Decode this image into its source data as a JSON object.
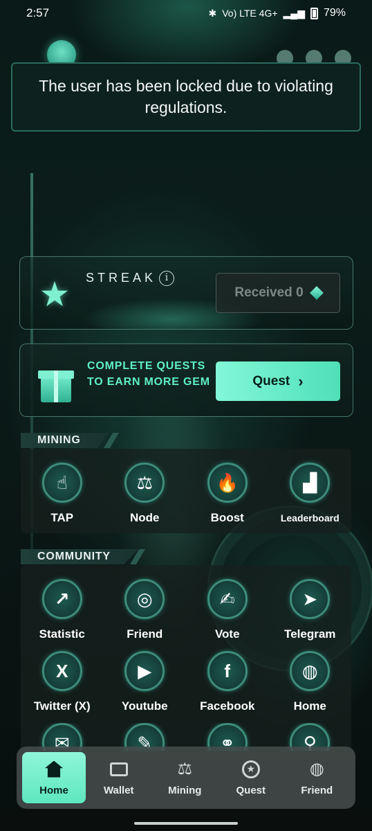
{
  "status_bar": {
    "time": "2:57",
    "network": "Vo) LTE 4G+",
    "battery": "79%"
  },
  "toast": {
    "message": "The user has been locked due to violating regulations."
  },
  "streak": {
    "title": "STREAK",
    "info_glyph": "i",
    "received_label": "Received 0"
  },
  "quest_card": {
    "text": "COMPLETE QUESTS TO EARN MORE GEM",
    "button_label": "Quest"
  },
  "mining": {
    "label": "MINING",
    "items": [
      {
        "label": "TAP",
        "icon": "tap-icon",
        "glyph": "☝"
      },
      {
        "label": "Node",
        "icon": "node-icon",
        "glyph": "⚖"
      },
      {
        "label": "Boost",
        "icon": "flame-icon",
        "glyph": "🔥"
      },
      {
        "label": "Leaderboard",
        "icon": "leaderboard-icon",
        "glyph": "▟"
      }
    ]
  },
  "community": {
    "label": "COMMUNITY",
    "items": [
      {
        "label": "Statistic",
        "icon": "statistic-icon",
        "glyph": "↗"
      },
      {
        "label": "Friend",
        "icon": "friend-network-icon",
        "glyph": "◎"
      },
      {
        "label": "Vote",
        "icon": "vote-icon",
        "glyph": "✍"
      },
      {
        "label": "Telegram",
        "icon": "telegram-icon",
        "glyph": "➤"
      },
      {
        "label": "Twitter (X)",
        "icon": "x-icon",
        "glyph": "X"
      },
      {
        "label": "Youtube",
        "icon": "youtube-icon",
        "glyph": "▶"
      },
      {
        "label": "Facebook",
        "icon": "facebook-icon",
        "glyph": "f"
      },
      {
        "label": "Home",
        "icon": "globe-icon",
        "glyph": "◍"
      }
    ]
  },
  "bottom_nav": {
    "items": [
      {
        "label": "Home",
        "icon": "home-icon",
        "active": true
      },
      {
        "label": "Wallet",
        "icon": "wallet-icon",
        "active": false
      },
      {
        "label": "Mining",
        "icon": "mining-icon",
        "active": false
      },
      {
        "label": "Quest",
        "icon": "quest-icon",
        "active": false
      },
      {
        "label": "Friend",
        "icon": "friend-icon",
        "active": false
      }
    ]
  },
  "colors": {
    "accent": "#5ff0c7",
    "background": "#071210",
    "toast_border": "#2a6b5d"
  }
}
